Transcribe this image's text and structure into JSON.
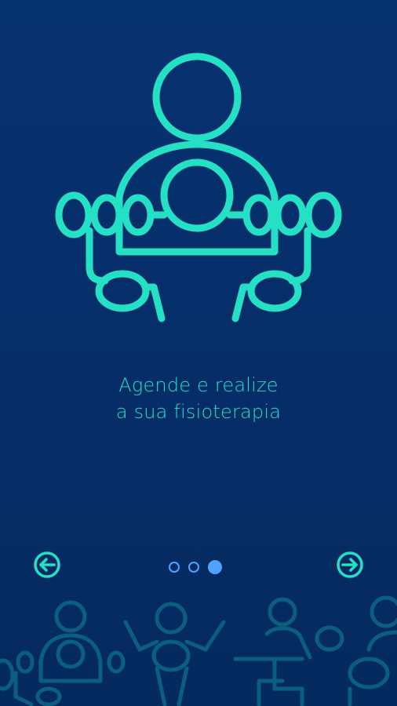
{
  "onboarding": {
    "caption_line1": "Agende e realize",
    "caption_line2": "a sua fisioterapia",
    "hero_icon": "physiotherapy-group-icon",
    "prev_icon": "arrow-left-icon",
    "next_icon": "arrow-right-icon",
    "page_total": 3,
    "page_current": 3
  },
  "colors": {
    "background": "#062e6a",
    "accent": "#24e0c4",
    "dot": "#4fa3ff",
    "footer_art": "#0f8a9c"
  }
}
